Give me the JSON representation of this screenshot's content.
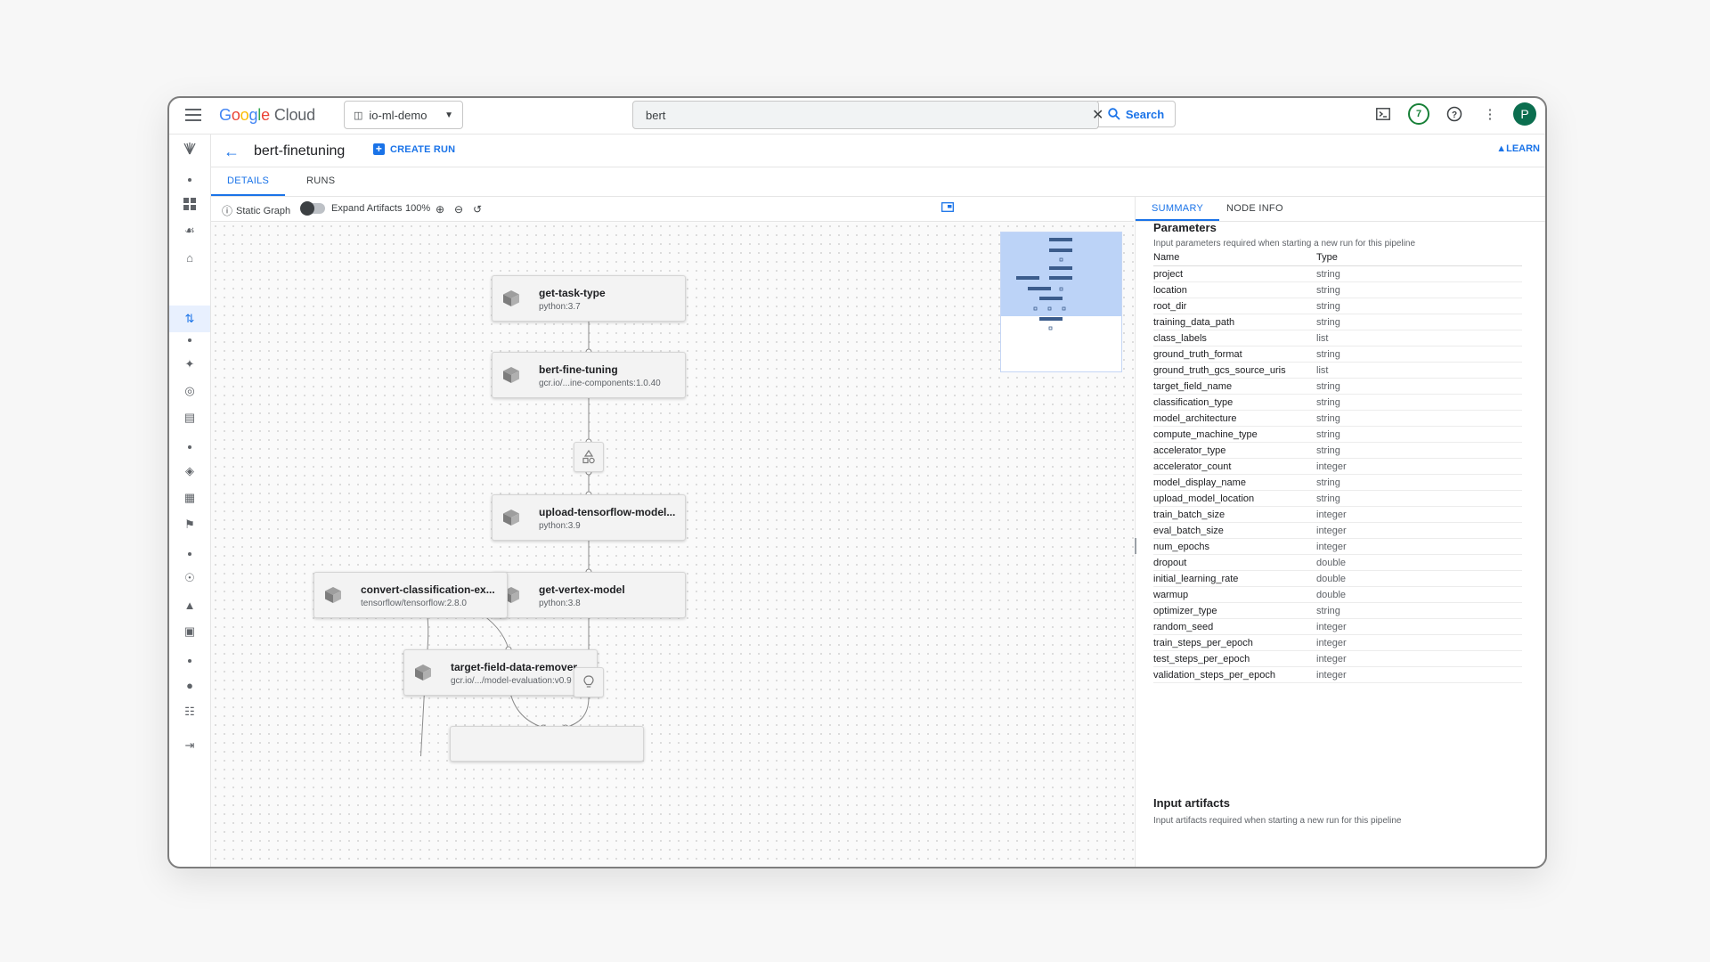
{
  "topbar": {
    "logo_google": "Google",
    "logo_cloud": "Cloud",
    "project": "io-ml-demo",
    "search_value": "bert",
    "search_button": "Search",
    "notification_count": "7",
    "avatar_initial": "P"
  },
  "header": {
    "title": "bert-finetuning",
    "create_run": "CREATE RUN",
    "learn": "LEARN"
  },
  "tabs": {
    "details": "DETAILS",
    "runs": "RUNS"
  },
  "toolbar": {
    "static_graph": "Static Graph",
    "expand_artifacts": "Expand Artifacts",
    "zoom": "100%"
  },
  "graph": {
    "nodes": [
      {
        "name": "get-task-type",
        "sub": "python:3.7"
      },
      {
        "name": "bert-fine-tuning",
        "sub": "gcr.io/...ine-components:1.0.40"
      },
      {
        "name": "upload-tensorflow-model...",
        "sub": "python:3.9"
      },
      {
        "name": "get-vertex-model",
        "sub": "python:3.8"
      },
      {
        "name": "convert-classification-ex...",
        "sub": "tensorflow/tensorflow:2.8.0"
      },
      {
        "name": "target-field-data-remover",
        "sub": "gcr.io/.../model-evaluation:v0.9"
      }
    ]
  },
  "panel": {
    "tabs": {
      "summary": "SUMMARY",
      "node_info": "NODE INFO"
    },
    "params_title": "Parameters",
    "params_desc": "Input parameters required when starting a new run for this pipeline",
    "col_name": "Name",
    "col_type": "Type",
    "params": [
      {
        "name": "project",
        "type": "string"
      },
      {
        "name": "location",
        "type": "string"
      },
      {
        "name": "root_dir",
        "type": "string"
      },
      {
        "name": "training_data_path",
        "type": "string"
      },
      {
        "name": "class_labels",
        "type": "list"
      },
      {
        "name": "ground_truth_format",
        "type": "string"
      },
      {
        "name": "ground_truth_gcs_source_uris",
        "type": "list"
      },
      {
        "name": "target_field_name",
        "type": "string"
      },
      {
        "name": "classification_type",
        "type": "string"
      },
      {
        "name": "model_architecture",
        "type": "string"
      },
      {
        "name": "compute_machine_type",
        "type": "string"
      },
      {
        "name": "accelerator_type",
        "type": "string"
      },
      {
        "name": "accelerator_count",
        "type": "integer"
      },
      {
        "name": "model_display_name",
        "type": "string"
      },
      {
        "name": "upload_model_location",
        "type": "string"
      },
      {
        "name": "train_batch_size",
        "type": "integer"
      },
      {
        "name": "eval_batch_size",
        "type": "integer"
      },
      {
        "name": "num_epochs",
        "type": "integer"
      },
      {
        "name": "dropout",
        "type": "double"
      },
      {
        "name": "initial_learning_rate",
        "type": "double"
      },
      {
        "name": "warmup",
        "type": "double"
      },
      {
        "name": "optimizer_type",
        "type": "string"
      },
      {
        "name": "random_seed",
        "type": "integer"
      },
      {
        "name": "train_steps_per_epoch",
        "type": "integer"
      },
      {
        "name": "test_steps_per_epoch",
        "type": "integer"
      },
      {
        "name": "validation_steps_per_epoch",
        "type": "integer"
      }
    ],
    "artifacts_title": "Input artifacts",
    "artifacts_desc": "Input artifacts required when starting a new run for this pipeline"
  },
  "icons": {
    "menu": "menu-icon",
    "cloud_shell": "terminal-icon",
    "help": "help-icon",
    "more": "more-vert-icon",
    "node": "cube-icon"
  }
}
